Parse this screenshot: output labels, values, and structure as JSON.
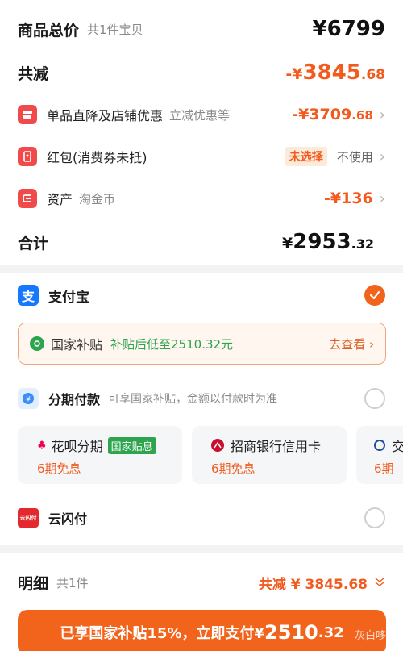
{
  "summary": {
    "total_label": "商品总价",
    "total_count": "共1件宝贝",
    "total_price": "¥6799",
    "reduce_label": "共减",
    "reduce_prefix": "-¥",
    "reduce_int": "3845",
    "reduce_dec": ".68"
  },
  "discounts": [
    {
      "label": "单品直降及店铺优惠",
      "sub": "立减优惠等",
      "amount_int": "-¥3709",
      "amount_dec": ".68"
    },
    {
      "label": "红包(消费券未抵)",
      "badge": "未选择",
      "value": "不使用"
    },
    {
      "label": "资产",
      "sub": "淘金币",
      "amount": "-¥136"
    }
  ],
  "subtotal": {
    "label": "合计",
    "prefix": "¥",
    "int": "2953",
    "dec": ".32"
  },
  "payment": {
    "alipay_label": "支付宝",
    "subsidy_label": "国家补贴",
    "subsidy_text": "补贴后低至2510.32元",
    "subsidy_link": "去查看 ›",
    "installment_label": "分期付款",
    "installment_sub": "可享国家补贴，金额以付款时为准",
    "cards": [
      {
        "name": "花呗分期",
        "tag": "国家贴息",
        "note": "6期免息"
      },
      {
        "name": "招商银行信用卡",
        "note": "6期免息"
      },
      {
        "name": "交",
        "note": "6期"
      }
    ],
    "unionpay_label": "云闪付",
    "unionpay_icon_text": "云闪付"
  },
  "detail": {
    "label": "明细",
    "count": "共1件",
    "reduce_text": "共减 ¥ 3845.68"
  },
  "pay_button": {
    "text": "已享国家补贴15%，立即支付¥",
    "amount_int": "2510",
    "amount_dec": ".32"
  },
  "watermark": "灰白哆",
  "colors": {
    "accent": "#f25a1e",
    "alipay": "#1677ff",
    "green": "#2ea44f"
  }
}
